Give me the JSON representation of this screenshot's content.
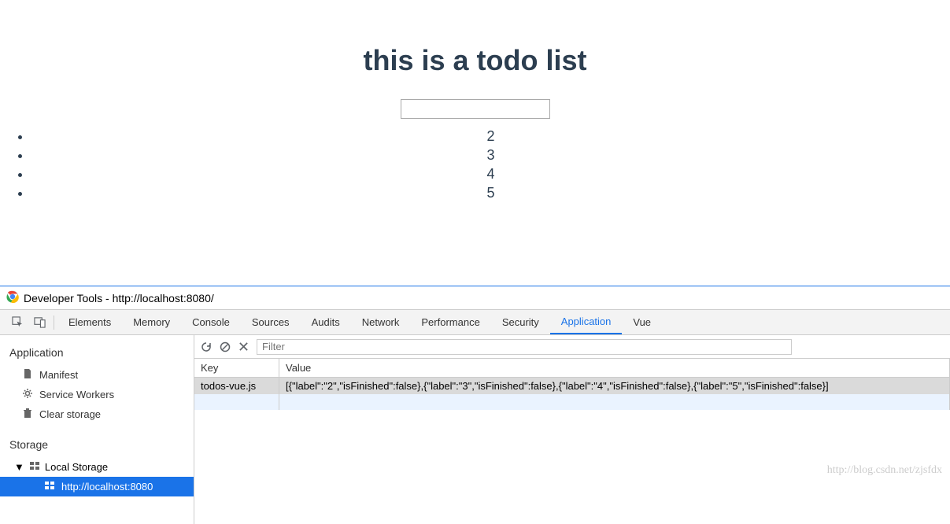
{
  "page": {
    "title": "this is a todo list",
    "input_value": "",
    "items": [
      "2",
      "3",
      "4",
      "5"
    ]
  },
  "devtools": {
    "window_title": "Developer Tools - http://localhost:8080/",
    "tabs": [
      "Elements",
      "Memory",
      "Console",
      "Sources",
      "Audits",
      "Network",
      "Performance",
      "Security",
      "Application",
      "Vue"
    ],
    "active_tab": "Application",
    "filter_placeholder": "Filter",
    "sidebar": {
      "group1_title": "Application",
      "group1_items": [
        "Manifest",
        "Service Workers",
        "Clear storage"
      ],
      "group2_title": "Storage",
      "group2_expand": "Local Storage",
      "group2_selected": "http://localhost:8080"
    },
    "table": {
      "headers": {
        "key": "Key",
        "value": "Value"
      },
      "rows": [
        {
          "key": "todos-vue.js",
          "value": "[{\"label\":\"2\",\"isFinished\":false},{\"label\":\"3\",\"isFinished\":false},{\"label\":\"4\",\"isFinished\":false},{\"label\":\"5\",\"isFinished\":false}]"
        }
      ]
    }
  },
  "watermark": "http://blog.csdn.net/zjsfdx"
}
